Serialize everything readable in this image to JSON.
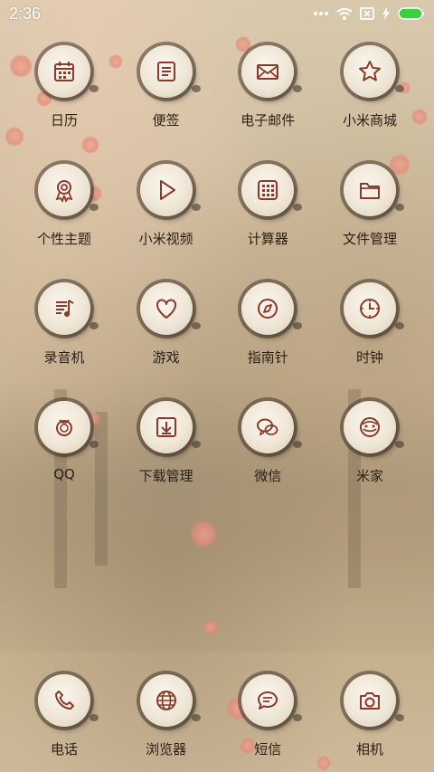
{
  "status_bar": {
    "time": "2:36",
    "icons": [
      "more-dots-icon",
      "wifi-icon",
      "no-sim-icon",
      "charging-bolt-icon",
      "battery-icon"
    ],
    "battery_color": "#3ecf3e"
  },
  "apps": [
    {
      "label": "日历",
      "icon": "calendar-icon"
    },
    {
      "label": "便签",
      "icon": "notes-icon"
    },
    {
      "label": "电子邮件",
      "icon": "mail-icon"
    },
    {
      "label": "小米商城",
      "icon": "star-icon"
    },
    {
      "label": "个性主题",
      "icon": "theme-badge-icon"
    },
    {
      "label": "小米视频",
      "icon": "play-icon"
    },
    {
      "label": "计算器",
      "icon": "calculator-icon"
    },
    {
      "label": "文件管理",
      "icon": "folder-icon"
    },
    {
      "label": "录音机",
      "icon": "recorder-icon"
    },
    {
      "label": "游戏",
      "icon": "heart-icon"
    },
    {
      "label": "指南针",
      "icon": "compass-icon"
    },
    {
      "label": "时钟",
      "icon": "clock-icon"
    },
    {
      "label": "QQ",
      "icon": "qq-icon"
    },
    {
      "label": "下载管理",
      "icon": "download-icon"
    },
    {
      "label": "微信",
      "icon": "wechat-icon"
    },
    {
      "label": "米家",
      "icon": "mijia-icon"
    }
  ],
  "dock": [
    {
      "label": "电话",
      "icon": "phone-icon"
    },
    {
      "label": "浏览器",
      "icon": "globe-icon"
    },
    {
      "label": "短信",
      "icon": "message-icon"
    },
    {
      "label": "相机",
      "icon": "camera-icon"
    }
  ],
  "colors": {
    "icon_stroke": "#8a3a2a",
    "label_text": "#2c2118",
    "icon_face": "#f3ece0"
  }
}
